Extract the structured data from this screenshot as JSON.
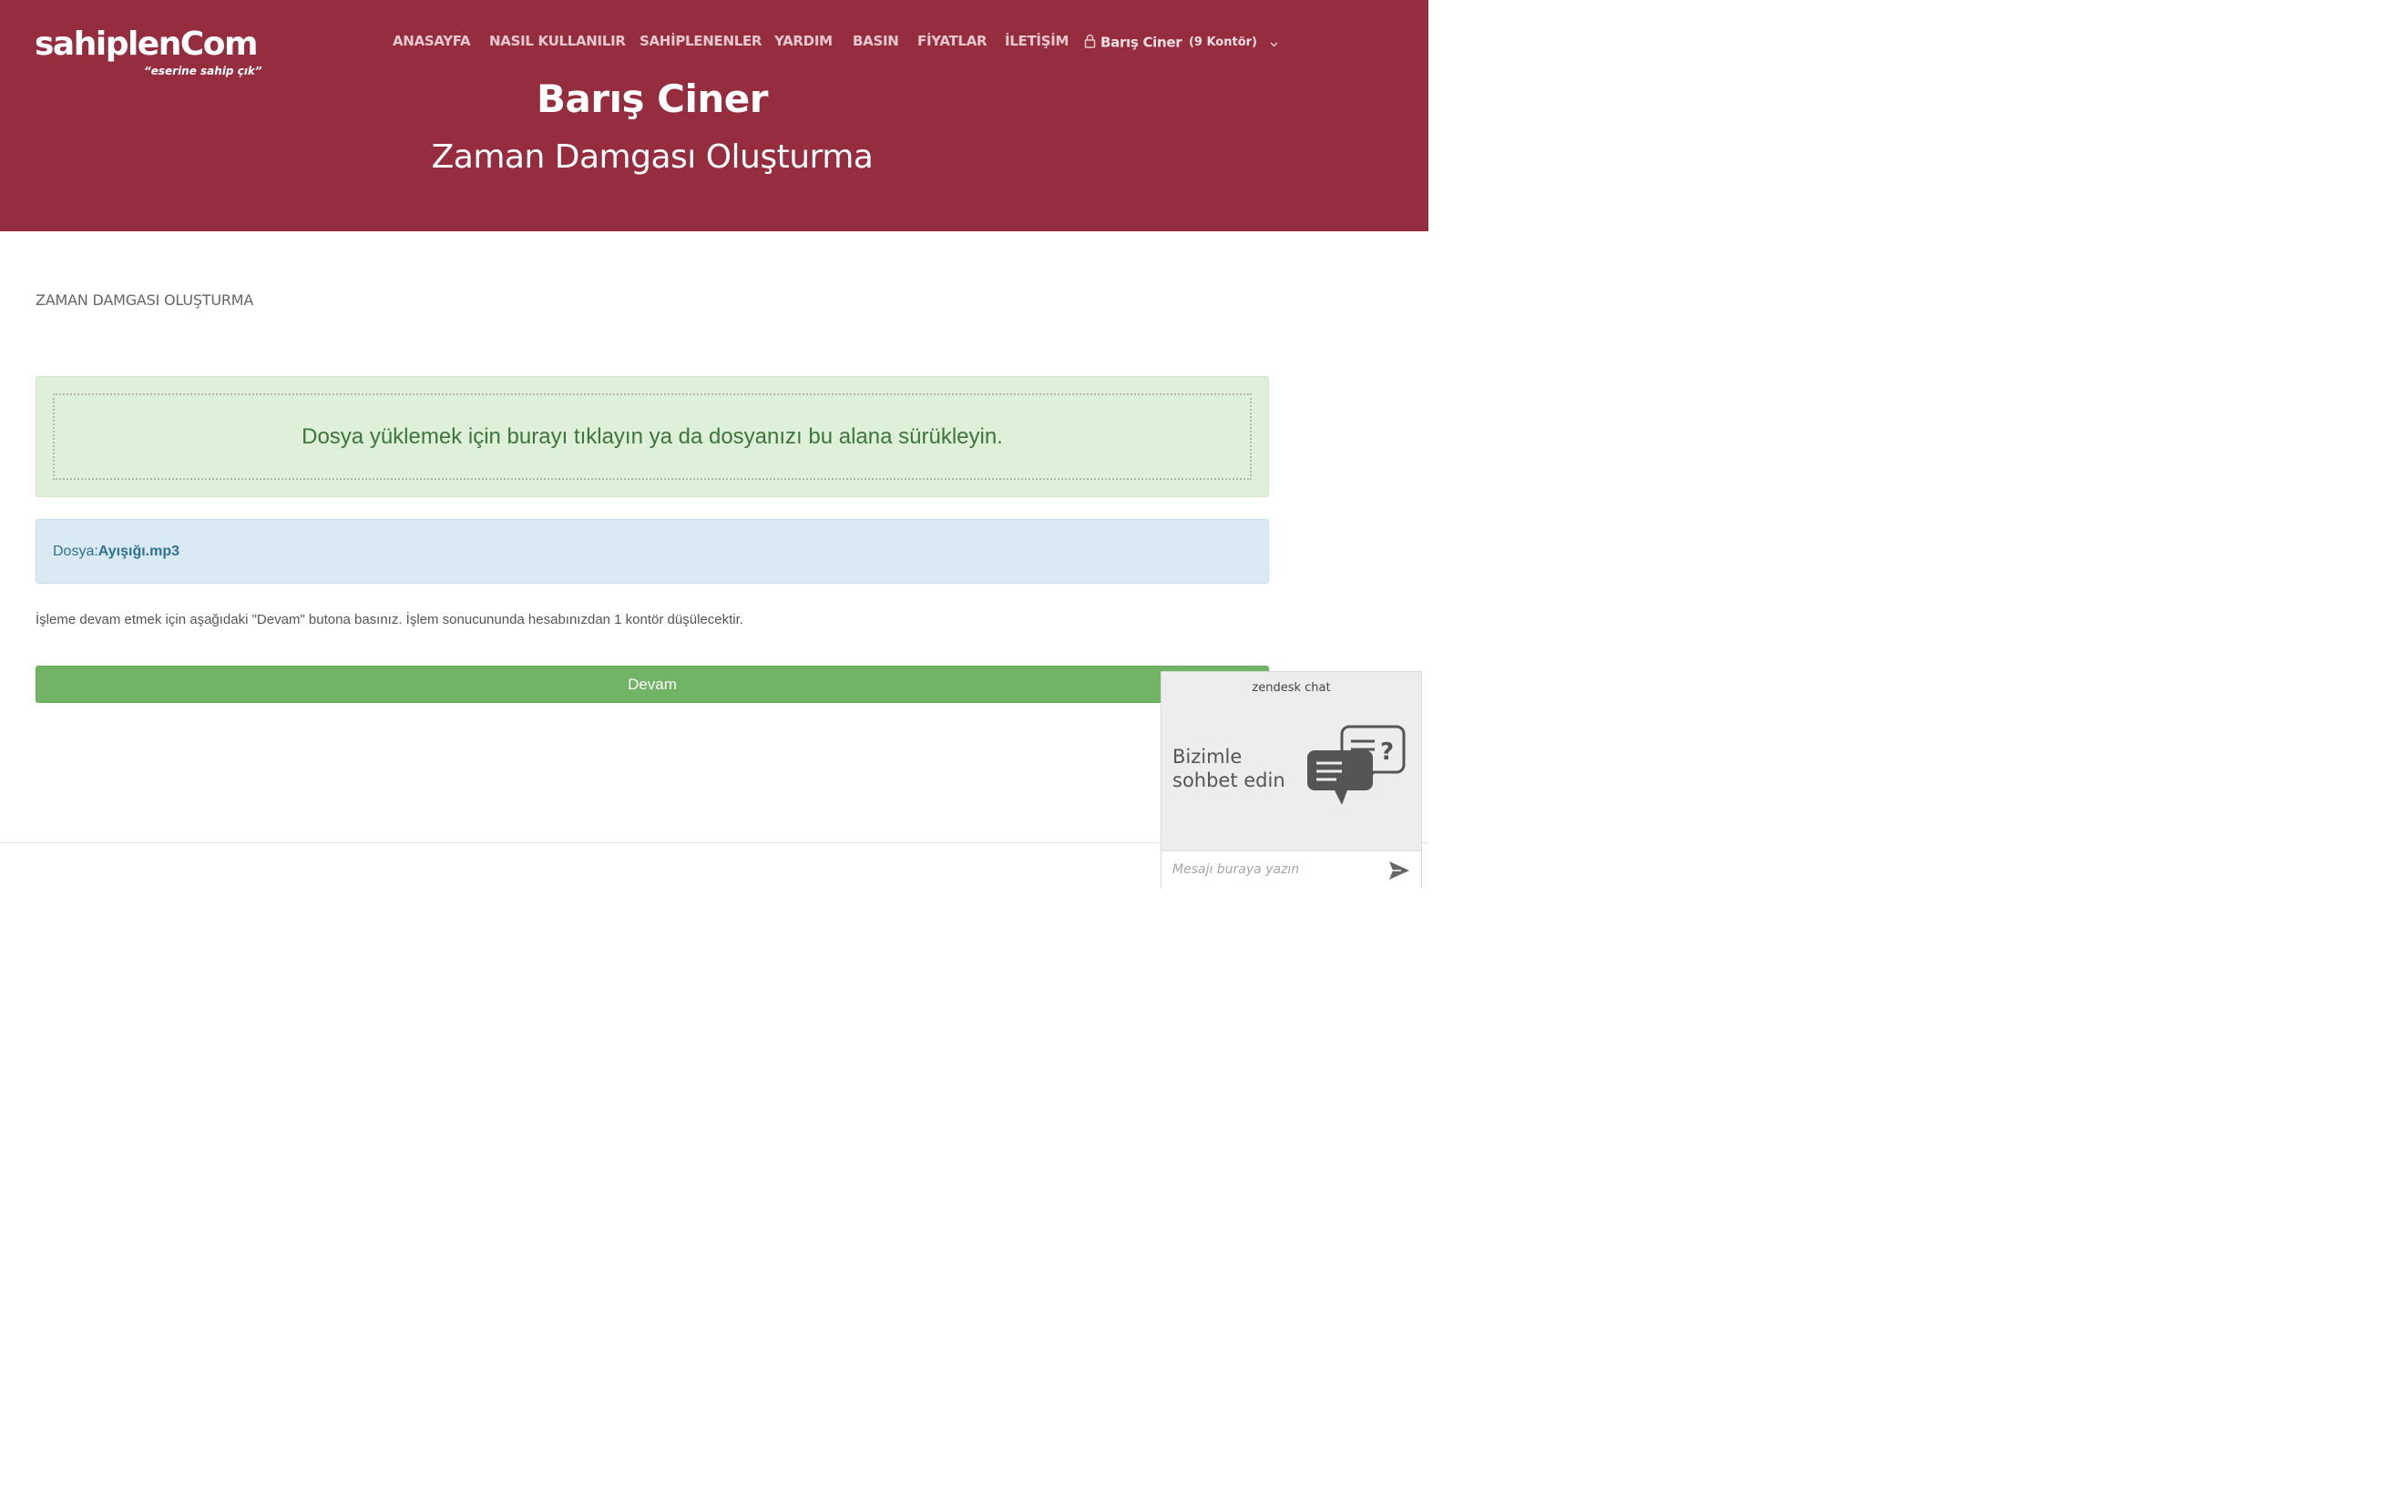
{
  "header": {
    "logo": {
      "name": "sahiplenCom",
      "tagline": "“eserine sahip çık”"
    },
    "nav": [
      {
        "label": "ANASAYFA"
      },
      {
        "label": "NASIL KULLANILIR"
      },
      {
        "label": "SAHİPLENENLER"
      },
      {
        "label": "YARDIM"
      },
      {
        "label": "BASIN"
      },
      {
        "label": "FİYATLAR"
      },
      {
        "label": "İLETİŞİM"
      }
    ],
    "user": {
      "name": "Barış Ciner",
      "credits": "(9 Kontör)",
      "icon": "lock-icon"
    },
    "hero_title": "Barış Ciner",
    "hero_subtitle": "Zaman Damgası Oluşturma"
  },
  "main": {
    "section_title": "ZAMAN DAMGASI OLUŞTURMA",
    "dropzone_text": "Dosya yüklemek için burayı tıklayın ya da dosyanızı bu alana sürükleyin.",
    "file_label": "Dosya:",
    "file_name": "Ayışığı.mp3",
    "instruction": "İşleme devam etmek için aşağıdaki \"Devam\" butona basınız. İşlem sonucununda hesabınızdan 1 kontör düşülecektir.",
    "continue_button": "Devam"
  },
  "chat": {
    "brand": "zendesk chat",
    "greeting": "Bizimle sohbet edin",
    "input_placeholder": "Mesajı buraya yazın",
    "icons": [
      "chat-bubble-icon",
      "send-icon"
    ]
  },
  "colors": {
    "header_bg": "#952d3f",
    "success_bg": "#dff0d8",
    "success_text": "#3c763d",
    "info_bg": "#d9eaf5",
    "info_text": "#31708f",
    "button_green": "#72b465"
  }
}
